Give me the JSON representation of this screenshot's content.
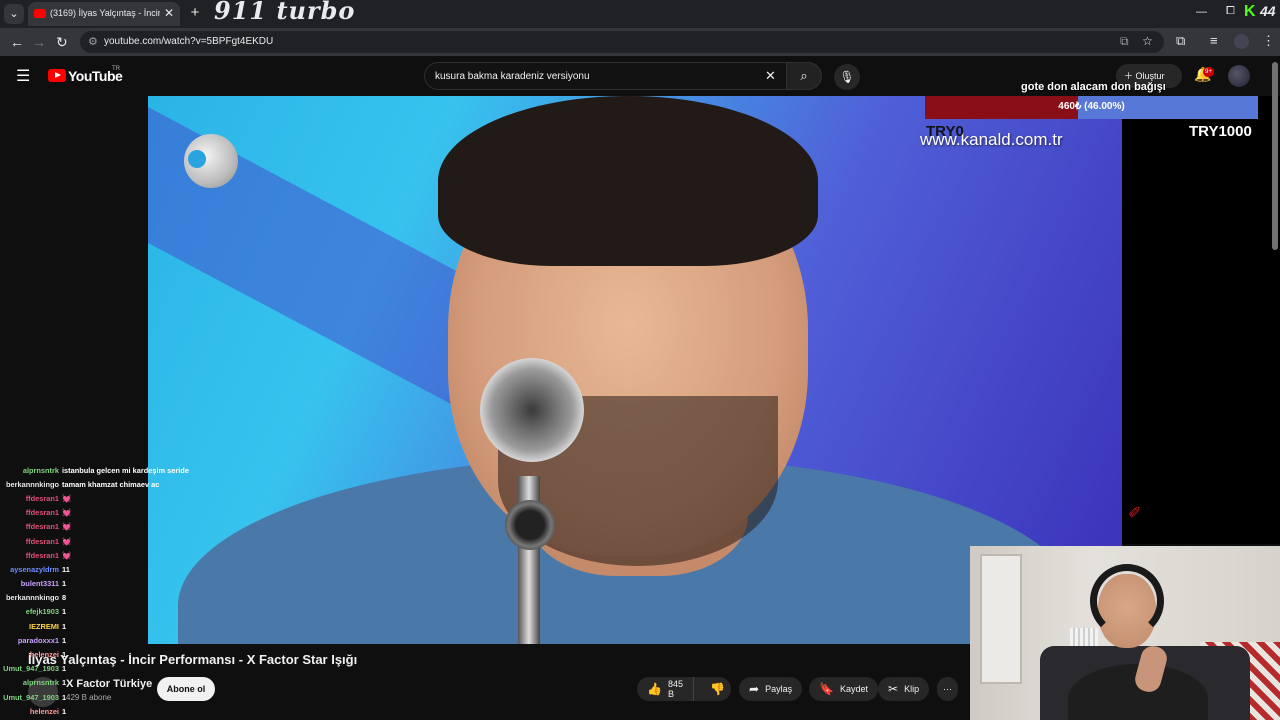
{
  "browser": {
    "tab_title": "(3169) İlyas Yalçıntaş - İncir Per",
    "new_tab": "+",
    "brand_text": "911 turbo",
    "url": "youtube.com/watch?v=5BPFgt4EKDU",
    "kick_count": "44"
  },
  "youtube": {
    "logo": "YouTube",
    "country": "TR",
    "search_query": "kusura bakma karadeniz versiyonu",
    "create_label": "Oluştur",
    "notifications_badge": "9+"
  },
  "overlay": {
    "kanal_url": "www.kanald.com.tr",
    "goal": {
      "title": "gote don alacam don bağışı",
      "progress_text": "460₺ (46.00%)",
      "progress_fraction": 0.46,
      "min_label": "TRY0",
      "max_label": "TRY1000",
      "fill_color": "#8a0e18",
      "bar_color": "#5878d8"
    },
    "chat": [
      {
        "user": "alprnsntrk",
        "msg": "istanbula gelcen mi kardeşim seride",
        "color": "#7fd67f"
      },
      {
        "user": "berkannnkingo",
        "msg": "tamam khamzat chimaev ac",
        "color": "#e6e6e6"
      },
      {
        "user": "ffdesran1",
        "msg": "💓",
        "color": "#e0507a"
      },
      {
        "user": "ffdesran1",
        "msg": "💓",
        "color": "#e0507a"
      },
      {
        "user": "ffdesran1",
        "msg": "💓",
        "color": "#e0507a"
      },
      {
        "user": "ffdesran1",
        "msg": "💓",
        "color": "#e0507a"
      },
      {
        "user": "ffdesran1",
        "msg": "💓",
        "color": "#e0507a"
      },
      {
        "user": "aysenazyldrm",
        "msg": "11",
        "color": "#6a8cff"
      },
      {
        "user": "bulent3311",
        "msg": "1",
        "color": "#c8a0ff"
      },
      {
        "user": "berkannnkingo",
        "msg": "8",
        "color": "#e6e6e6"
      },
      {
        "user": "efejk1903",
        "msg": "1",
        "color": "#7fd67f"
      },
      {
        "user": "IEZREMI",
        "msg": "1",
        "color": "#ffd54a"
      },
      {
        "user": "paradoxxx1",
        "msg": "1",
        "color": "#c8a0ff"
      },
      {
        "user": "helenzei",
        "msg": "1",
        "color": "#ff9a9a"
      },
      {
        "user": "Umut_947_1903",
        "msg": "1",
        "color": "#7fd67f"
      },
      {
        "user": "alprnsntrk",
        "msg": "1",
        "color": "#7fd67f"
      },
      {
        "user": "Umut_947_1903",
        "msg": "1",
        "color": "#7fd67f"
      },
      {
        "user": "helenzei",
        "msg": "1",
        "color": "#ff9a9a"
      }
    ]
  },
  "video": {
    "title": "İlyas Yalçıntaş - İncir Performansı - X Factor Star Işığı",
    "channel": "X Factor Türkiye",
    "subscribers": "429 B abone",
    "subscribe_label": "Abone ol",
    "likes": "845 B",
    "share_label": "Paylaş",
    "save_label": "Kaydet",
    "clip_label": "Klip",
    "more_label": "···"
  },
  "icons": {
    "menu": "☰",
    "search": "⌕",
    "mic": "🎙",
    "bell": "🔔",
    "like": "👍",
    "dislike": "👎",
    "share": "➦",
    "save": "🔖",
    "clip": "✂",
    "back": "←",
    "forward": "→",
    "reload": "↻",
    "close": "✕",
    "star": "☆",
    "cast": "⧉",
    "extensions": "⧉",
    "minimize": "—",
    "restore": "⧠"
  }
}
